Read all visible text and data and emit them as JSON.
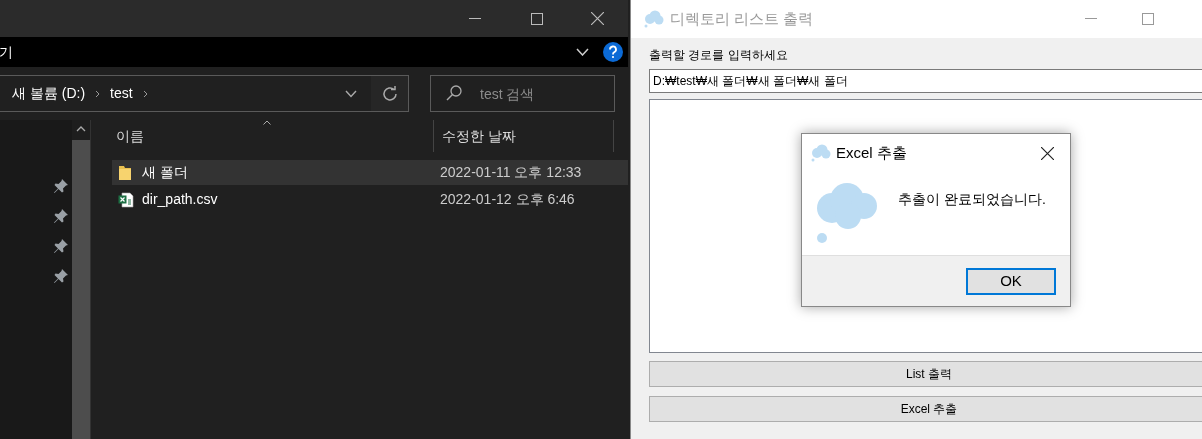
{
  "explorer": {
    "ribbon_label": "기",
    "breadcrumb": [
      {
        "label": "새 볼륨 (D:)"
      },
      {
        "label": "test"
      }
    ],
    "search": {
      "placeholder": "test 검색"
    },
    "columns": [
      "이름",
      "수정한 날짜"
    ],
    "rows": [
      {
        "kind": "folder",
        "name": "새 폴더",
        "modified": "2022-01-11 오후 12:33",
        "selected": true
      },
      {
        "kind": "csv",
        "name": "dir_path.csv",
        "modified": "2022-01-12 오후 6:46",
        "selected": false
      }
    ]
  },
  "app": {
    "title": "디렉토리 리스트 출력",
    "prompt": "출력할 경로를 입력하세요",
    "path": "D:₩test₩새 폴더₩새 폴더₩새 폴더",
    "buttons": [
      "List 출력",
      "Excel 추출"
    ]
  },
  "dialog": {
    "title": "Excel 추출",
    "message": "추출이 완료되었습니다.",
    "button": "OK"
  }
}
